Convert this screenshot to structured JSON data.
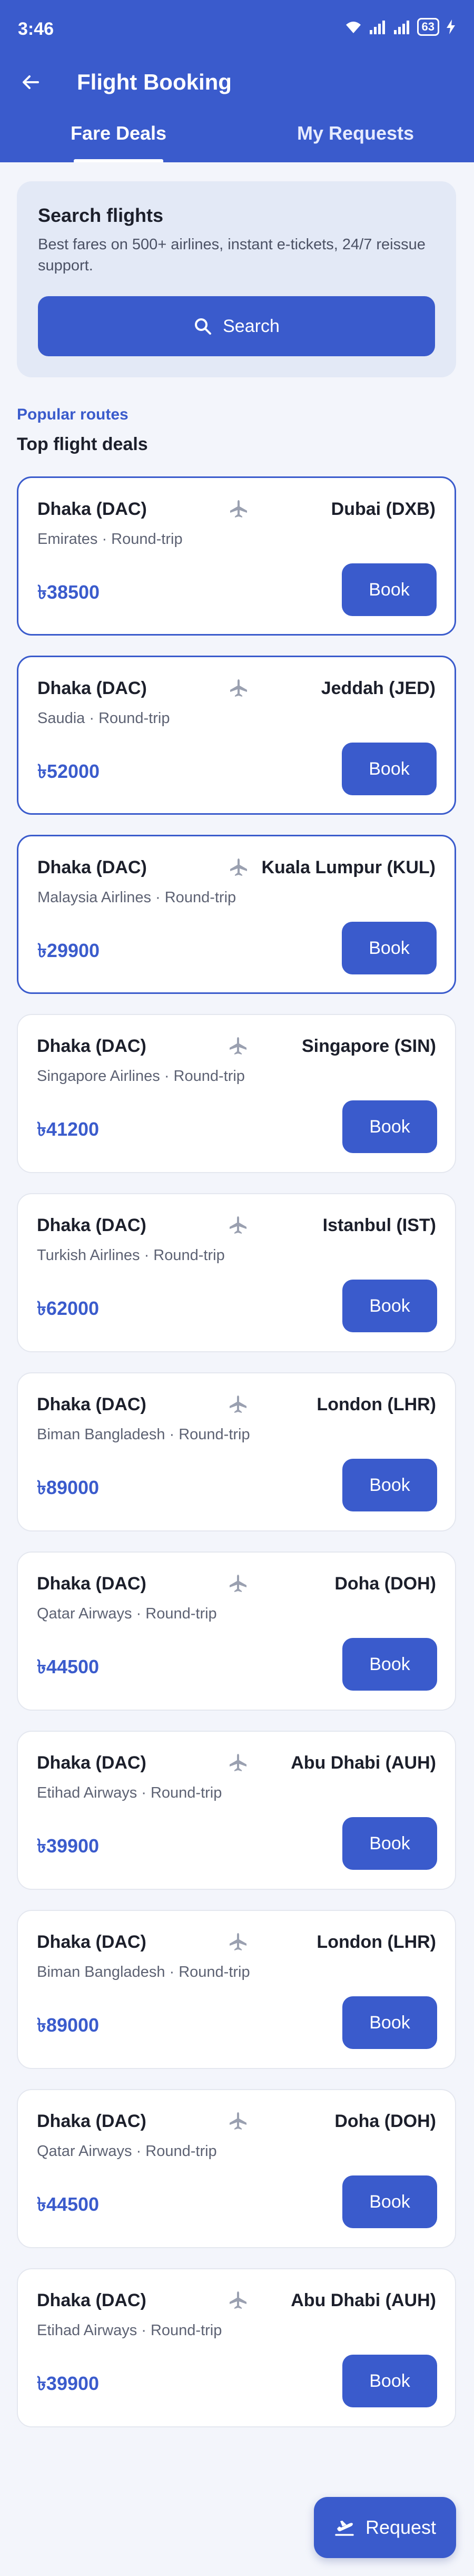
{
  "status": {
    "time": "3:46",
    "battery": "63"
  },
  "appbar": {
    "title": "Flight Booking"
  },
  "tabs": [
    {
      "label": "Fare Deals",
      "active": true
    },
    {
      "label": "My Requests",
      "active": false
    }
  ],
  "search": {
    "title": "Search flights",
    "description": "Best fares on 500+ airlines, instant e-tickets, 24/7 reissue support.",
    "button_label": "Search"
  },
  "section": {
    "label": "Popular routes",
    "title": "Top flight deals"
  },
  "deals": [
    {
      "from": "Dhaka (DAC)",
      "to": "Dubai (DXB)",
      "airline": "Emirates · Round-trip",
      "price": "৳38500",
      "book_label": "Book",
      "highlight": true
    },
    {
      "from": "Dhaka (DAC)",
      "to": "Jeddah (JED)",
      "airline": "Saudia · Round-trip",
      "price": "৳52000",
      "book_label": "Book",
      "highlight": true
    },
    {
      "from": "Dhaka (DAC)",
      "to": "Kuala Lumpur (KUL)",
      "airline": "Malaysia Airlines · Round-trip",
      "price": "৳29900",
      "book_label": "Book",
      "highlight": true
    },
    {
      "from": "Dhaka (DAC)",
      "to": "Singapore (SIN)",
      "airline": "Singapore Airlines · Round-trip",
      "price": "৳41200",
      "book_label": "Book",
      "highlight": false
    },
    {
      "from": "Dhaka (DAC)",
      "to": "Istanbul (IST)",
      "airline": "Turkish Airlines · Round-trip",
      "price": "৳62000",
      "book_label": "Book",
      "highlight": false
    },
    {
      "from": "Dhaka (DAC)",
      "to": "London (LHR)",
      "airline": "Biman Bangladesh · Round-trip",
      "price": "৳89000",
      "book_label": "Book",
      "highlight": false
    },
    {
      "from": "Dhaka (DAC)",
      "to": "Doha (DOH)",
      "airline": "Qatar Airways · Round-trip",
      "price": "৳44500",
      "book_label": "Book",
      "highlight": false
    },
    {
      "from": "Dhaka (DAC)",
      "to": "Abu Dhabi (AUH)",
      "airline": "Etihad Airways · Round-trip",
      "price": "৳39900",
      "book_label": "Book",
      "highlight": false
    },
    {
      "from": "Dhaka (DAC)",
      "to": "London (LHR)",
      "airline": "Biman Bangladesh · Round-trip",
      "price": "৳89000",
      "book_label": "Book",
      "highlight": false
    },
    {
      "from": "Dhaka (DAC)",
      "to": "Doha (DOH)",
      "airline": "Qatar Airways · Round-trip",
      "price": "৳44500",
      "book_label": "Book",
      "highlight": false
    },
    {
      "from": "Dhaka (DAC)",
      "to": "Abu Dhabi (AUH)",
      "airline": "Etihad Airways · Round-trip",
      "price": "৳39900",
      "book_label": "Book",
      "highlight": false
    }
  ],
  "fab": {
    "label": "Request"
  },
  "colors": {
    "primary": "#3a5bcc",
    "background": "#f3f5fb",
    "card_tint": "#e3e9f6"
  },
  "icons": {
    "back": "arrow-left-icon",
    "search": "search-icon",
    "plane": "airplane-icon",
    "fab": "flight-takeoff-icon"
  }
}
